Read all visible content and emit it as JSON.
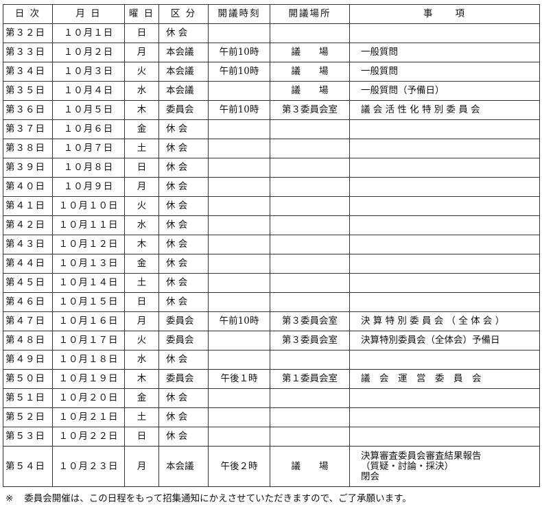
{
  "headers": [
    "日 次",
    "月 日",
    "曜 日",
    "区 分",
    "開議時刻",
    "開議場所",
    "事　　項"
  ],
  "rows": [
    {
      "day": "第３２日",
      "date": "１０月１日",
      "weekday": "日",
      "type": "休 会",
      "time": "",
      "place": "",
      "items": []
    },
    {
      "day": "第３３日",
      "date": "１０月２日",
      "weekday": "月",
      "type": "本会議",
      "time": "午前10時",
      "place": "議　　場",
      "items": [
        "一般質問"
      ]
    },
    {
      "day": "第３４日",
      "date": "１０月３日",
      "weekday": "火",
      "type": "本会議",
      "time": "午前10時",
      "place": "議　　場",
      "items": [
        "一般質問"
      ]
    },
    {
      "day": "第３５日",
      "date": "１０月４日",
      "weekday": "水",
      "type": "本会議",
      "time": "",
      "place": "議　　場",
      "items": [
        "一般質問（予備日）"
      ]
    },
    {
      "day": "第３６日",
      "date": "１０月５日",
      "weekday": "木",
      "type": "委員会",
      "time": "午前10時",
      "place": "第３委員会室",
      "items": [
        "議 会 活 性 化 特 別 委 員 会"
      ]
    },
    {
      "day": "第３７日",
      "date": "１０月６日",
      "weekday": "金",
      "type": "休 会",
      "time": "",
      "place": "",
      "items": []
    },
    {
      "day": "第３８日",
      "date": "１０月７日",
      "weekday": "土",
      "type": "休 会",
      "time": "",
      "place": "",
      "items": []
    },
    {
      "day": "第３９日",
      "date": "１０月８日",
      "weekday": "日",
      "type": "休 会",
      "time": "",
      "place": "",
      "items": []
    },
    {
      "day": "第４０日",
      "date": "１０月９日",
      "weekday": "月",
      "type": "休 会",
      "time": "",
      "place": "",
      "items": []
    },
    {
      "day": "第４１日",
      "date": "１０月１０日",
      "weekday": "火",
      "type": "休 会",
      "time": "",
      "place": "",
      "items": []
    },
    {
      "day": "第４２日",
      "date": "１０月１１日",
      "weekday": "水",
      "type": "休 会",
      "time": "",
      "place": "",
      "items": []
    },
    {
      "day": "第４３日",
      "date": "１０月１２日",
      "weekday": "木",
      "type": "休 会",
      "time": "",
      "place": "",
      "items": []
    },
    {
      "day": "第４４日",
      "date": "１０月１３日",
      "weekday": "金",
      "type": "休 会",
      "time": "",
      "place": "",
      "items": []
    },
    {
      "day": "第４５日",
      "date": "１０月１４日",
      "weekday": "土",
      "type": "休 会",
      "time": "",
      "place": "",
      "items": []
    },
    {
      "day": "第４６日",
      "date": "１０月１５日",
      "weekday": "日",
      "type": "休 会",
      "time": "",
      "place": "",
      "items": []
    },
    {
      "day": "第４７日",
      "date": "１０月１６日",
      "weekday": "月",
      "type": "委員会",
      "time": "午前10時",
      "place": "第３委員会室",
      "items": [
        "決 算 特 別 委 員 会 （ 全 体 会 ）"
      ]
    },
    {
      "day": "第４８日",
      "date": "１０月１７日",
      "weekday": "火",
      "type": "委員会",
      "time": "",
      "place": "第３委員会室",
      "items": [
        "決算特別委員会（全体会）予備日"
      ]
    },
    {
      "day": "第４９日",
      "date": "１０月１８日",
      "weekday": "水",
      "type": "休 会",
      "time": "",
      "place": "",
      "items": []
    },
    {
      "day": "第５０日",
      "date": "１０月１９日",
      "weekday": "木",
      "type": "委員会",
      "time": "午後１時",
      "place": "第１委員会室",
      "items": [
        "議　会　運　営　委　員　会"
      ]
    },
    {
      "day": "第５１日",
      "date": "１０月２０日",
      "weekday": "金",
      "type": "休 会",
      "time": "",
      "place": "",
      "items": []
    },
    {
      "day": "第５２日",
      "date": "１０月２１日",
      "weekday": "土",
      "type": "休 会",
      "time": "",
      "place": "",
      "items": []
    },
    {
      "day": "第５３日",
      "date": "１０月２２日",
      "weekday": "日",
      "type": "休 会",
      "time": "",
      "place": "",
      "items": []
    },
    {
      "day": "第５４日",
      "date": "１０月２３日",
      "weekday": "月",
      "type": "本会議",
      "time": "午後２時",
      "place": "議　　場",
      "items": [
        "決算審査委員会審査結果報告",
        "（質疑・討論・採決）",
        "閉会"
      ]
    }
  ],
  "note": {
    "mark": "※",
    "text": "委員会開催は、この日程をもって招集通知にかえさせていただきますので、ご了承願います。"
  }
}
